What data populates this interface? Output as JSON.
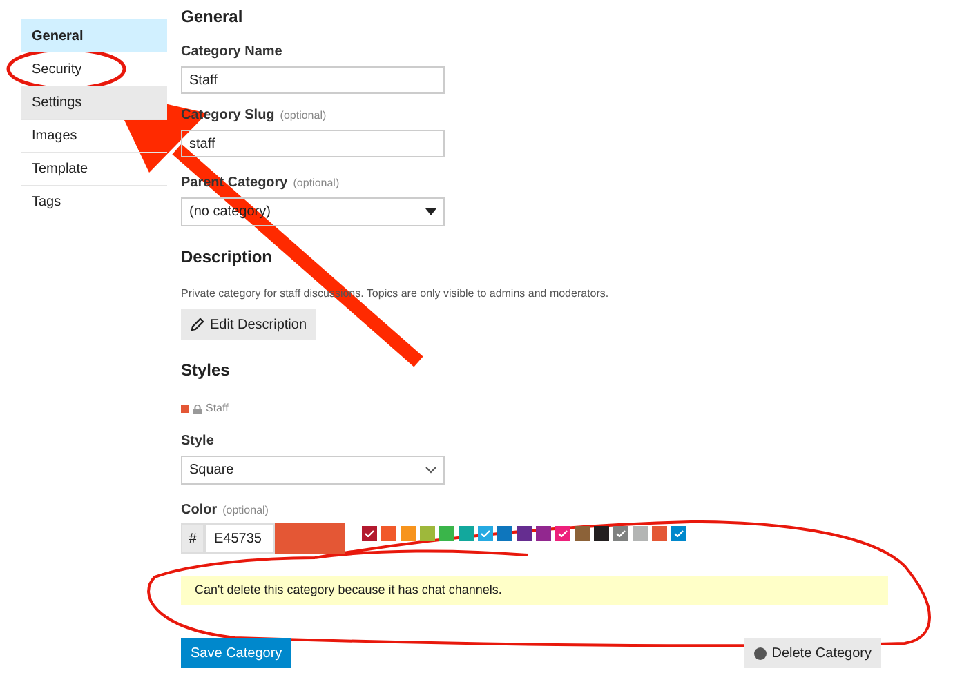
{
  "sidebar": {
    "items": [
      {
        "label": "General",
        "selected": true,
        "highlighted": false
      },
      {
        "label": "Security",
        "selected": false,
        "highlighted": false
      },
      {
        "label": "Settings",
        "selected": false,
        "highlighted": true
      },
      {
        "label": "Images",
        "selected": false,
        "highlighted": false
      },
      {
        "label": "Template",
        "selected": false,
        "highlighted": false
      },
      {
        "label": "Tags",
        "selected": false,
        "highlighted": false
      }
    ]
  },
  "general": {
    "title": "General",
    "name_field": {
      "label": "Category Name",
      "value": "Staff"
    },
    "slug_field": {
      "label": "Category Slug",
      "hint": "(optional)",
      "value": "staff"
    },
    "parent_field": {
      "label": "Parent Category",
      "hint": "(optional)",
      "value": "(no category)"
    }
  },
  "description": {
    "title": "Description",
    "text": "Private category for staff discussions. Topics are only visible to admins and moderators.",
    "edit_button": "Edit Description"
  },
  "styles": {
    "title": "Styles",
    "preview": {
      "name": "Staff",
      "color": "#e45735"
    },
    "style_field": {
      "label": "Style",
      "value": "Square"
    },
    "color_field": {
      "label": "Color",
      "hint": "(optional)",
      "prefix": "#",
      "value": "E45735",
      "color": "#e45735"
    },
    "swatches": [
      {
        "color": "#b3192e",
        "checked": true
      },
      {
        "color": "#f1592a",
        "checked": false
      },
      {
        "color": "#f7941d",
        "checked": false
      },
      {
        "color": "#9eb83b",
        "checked": false
      },
      {
        "color": "#3ab54a",
        "checked": false
      },
      {
        "color": "#12a89d",
        "checked": false
      },
      {
        "color": "#25aae2",
        "checked": true
      },
      {
        "color": "#0e76bd",
        "checked": false
      },
      {
        "color": "#652d90",
        "checked": false
      },
      {
        "color": "#92278f",
        "checked": false
      },
      {
        "color": "#ed207b",
        "checked": true
      },
      {
        "color": "#8c6238",
        "checked": false
      },
      {
        "color": "#231f20",
        "checked": false
      },
      {
        "color": "#808281",
        "checked": true
      },
      {
        "color": "#b3b5b4",
        "checked": false
      },
      {
        "color": "#e45735",
        "checked": false
      },
      {
        "color": "#0088cc",
        "checked": true
      }
    ]
  },
  "notice": "Can't delete this category because it has chat channels.",
  "buttons": {
    "save": "Save Category",
    "delete": "Delete Category"
  }
}
